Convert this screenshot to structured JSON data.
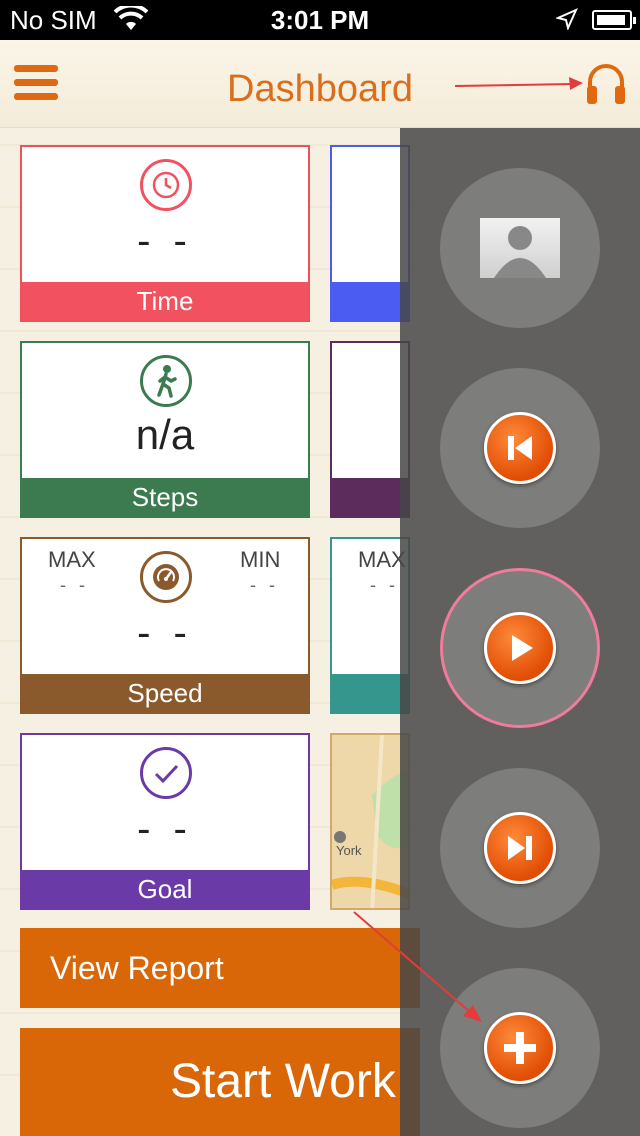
{
  "status_bar": {
    "carrier": "No SIM",
    "time": "3:01 PM"
  },
  "nav": {
    "title": "Dashboard",
    "menu_icon": "hamburger-menu-icon",
    "audio_icon": "headphones-icon"
  },
  "tiles": {
    "time": {
      "value": "- -",
      "label": "Time",
      "color": "#f2525f"
    },
    "steps": {
      "value": "n/a",
      "label": "Steps",
      "color": "#3c7b4f"
    },
    "speed": {
      "max_label": "MAX",
      "max_value": "- -",
      "min_label": "MIN",
      "min_value": "- -",
      "value": "- -",
      "label": "Speed",
      "color": "#8a5a2d"
    },
    "goal": {
      "value": "- -",
      "label": "Goal",
      "color": "#6a3aa6"
    },
    "right_partial": {
      "max_label": "MAX",
      "max_value": "- -",
      "map_text": "York"
    }
  },
  "buttons": {
    "view_report": "View Report",
    "start_workout": "Start Work"
  },
  "overlay": {
    "items": [
      "profile-avatar",
      "previous-track",
      "play",
      "next-track",
      "add"
    ],
    "active_item": "play"
  },
  "colors": {
    "accent": "#d96607",
    "title": "#d96f1c"
  }
}
